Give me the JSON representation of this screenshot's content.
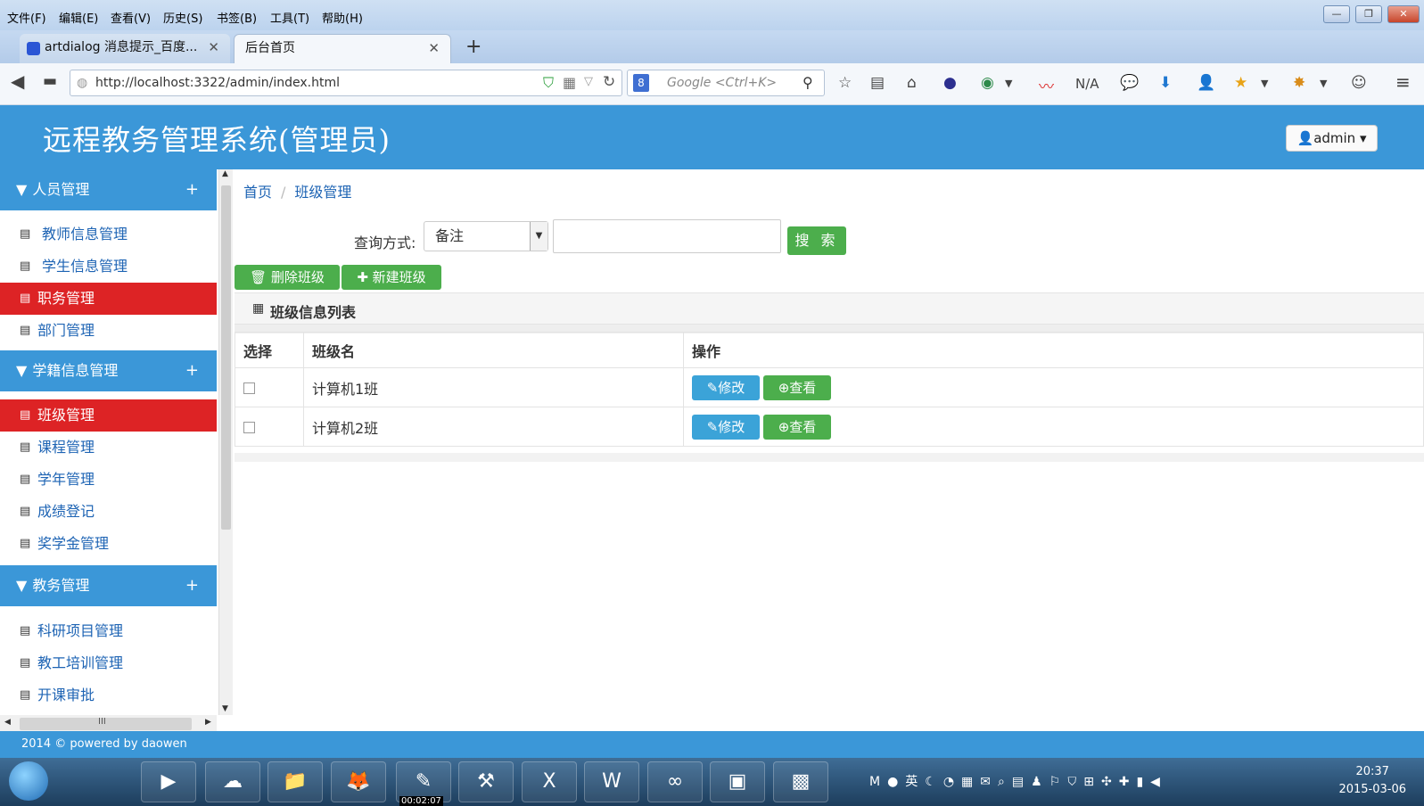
{
  "browser": {
    "menu": [
      "文件(F)",
      "编辑(E)",
      "查看(V)",
      "历史(S)",
      "书签(B)",
      "工具(T)",
      "帮助(H)"
    ],
    "tabs": [
      {
        "label": "artdialog 消息提示_百度..."
      },
      {
        "label": "后台首页"
      }
    ],
    "url": "http://localhost:3322/admin/index.html",
    "search_placeholder": "Google <Ctrl+K>",
    "toolbar_na": "N/A"
  },
  "header": {
    "title": "远程教务管理系统(管理员)",
    "admin_label": "admin"
  },
  "sidebar": {
    "sections": [
      {
        "label": "人员管理",
        "items": [
          "教师信息管理",
          "学生信息管理",
          "职务管理",
          "部门管理"
        ]
      },
      {
        "label": "学籍信息管理",
        "items": [
          "班级管理",
          "课程管理",
          "学年管理",
          "成绩登记",
          "奖学金管理"
        ]
      },
      {
        "label": "教务管理",
        "items": [
          "科研项目管理",
          "教工培训管理",
          "开课审批"
        ]
      }
    ],
    "scroll_h_label": "III"
  },
  "breadcrumb": {
    "home": "首页",
    "current": "班级管理"
  },
  "query": {
    "label": "查询方式:",
    "selected": "备注",
    "input_value": "",
    "search_button": "搜 索"
  },
  "actions": {
    "delete": "删除班级",
    "create": "新建班级"
  },
  "panel": {
    "title": "班级信息列表"
  },
  "table": {
    "headers": [
      "选择",
      "班级名",
      "操作"
    ],
    "rows": [
      {
        "name": "计算机1班",
        "edit": "修改",
        "view": "查看"
      },
      {
        "name": "计算机2班",
        "edit": "修改",
        "view": "查看"
      }
    ]
  },
  "footer": {
    "text": "2014 © powered by daowen"
  },
  "taskbar": {
    "time": "20:37",
    "date": "2015-03-06",
    "recording": "00:02:07"
  },
  "colors": {
    "primary": "#3b97d8",
    "selected": "#dd2325",
    "success": "#4cae4c",
    "info": "#3ba3d8"
  }
}
